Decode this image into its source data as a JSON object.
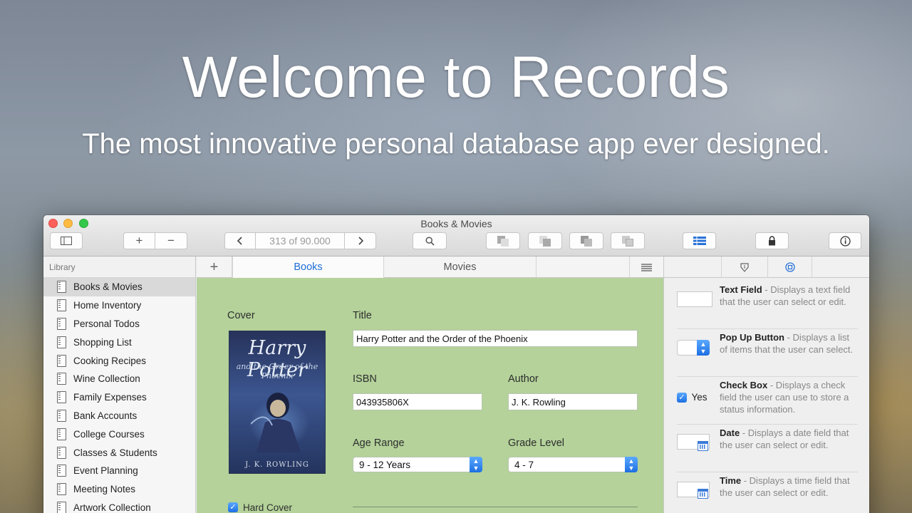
{
  "hero": {
    "title": "Welcome to Records",
    "subtitle": "The most innovative personal database app ever designed."
  },
  "window": {
    "title": "Books & Movies",
    "toolbar": {
      "counter": "313 of 90.000",
      "icons": [
        "sidebar-toggle-icon",
        "plus-icon",
        "minus-icon",
        "chevron-left-icon",
        "chevron-right-icon",
        "search-icon",
        "layout-icon",
        "list-view-icon",
        "lock-icon",
        "info-icon"
      ]
    }
  },
  "sidebar": {
    "header": "Library",
    "items": [
      {
        "label": "Books & Movies",
        "selected": true
      },
      {
        "label": "Home Inventory"
      },
      {
        "label": "Personal Todos"
      },
      {
        "label": "Shopping List"
      },
      {
        "label": "Cooking Recipes"
      },
      {
        "label": "Wine Collection"
      },
      {
        "label": "Family Expenses"
      },
      {
        "label": "Bank Accounts"
      },
      {
        "label": "College Courses"
      },
      {
        "label": "Classes & Students"
      },
      {
        "label": "Event Planning"
      },
      {
        "label": "Meeting Notes"
      },
      {
        "label": "Artwork Collection"
      }
    ]
  },
  "tabs": [
    {
      "label": "Books",
      "active": true
    },
    {
      "label": "Movies"
    }
  ],
  "form": {
    "cover_label": "Cover",
    "cover_art": {
      "title": "Harry Potter",
      "subtitle": "and the Order of the Phoenix",
      "author": "J. K. ROWLING"
    },
    "title_label": "Title",
    "title_value": "Harry Potter and the Order of the Phoenix",
    "isbn_label": "ISBN",
    "isbn_value": "043935806X",
    "author_label": "Author",
    "author_value": "J. K. Rowling",
    "age_label": "Age Range",
    "age_value": "9 - 12 Years",
    "grade_label": "Grade Level",
    "grade_value": "4 - 7",
    "hardcover_label": "Hard Cover",
    "hardcover_checked": true
  },
  "inspector": {
    "items": [
      {
        "name": "Text Field",
        "desc": " - Displays a text field that the user can select or edit."
      },
      {
        "name": "Pop Up Button",
        "desc": " - Displays a list of items that the user can select."
      },
      {
        "name": "Check Box",
        "desc": " - Displays a check field the user can use to store a status information.",
        "preview_label": "Yes"
      },
      {
        "name": "Date",
        "desc": " - Displays a date field that the user can select or edit."
      },
      {
        "name": "Time",
        "desc": " - Displays a time field that the user can select or edit."
      }
    ]
  },
  "colors": {
    "accent": "#1f6fd6",
    "form_background": "#b4d29a",
    "close": "#fc605b",
    "minimize": "#fdbc40",
    "maximize": "#34c84a"
  }
}
